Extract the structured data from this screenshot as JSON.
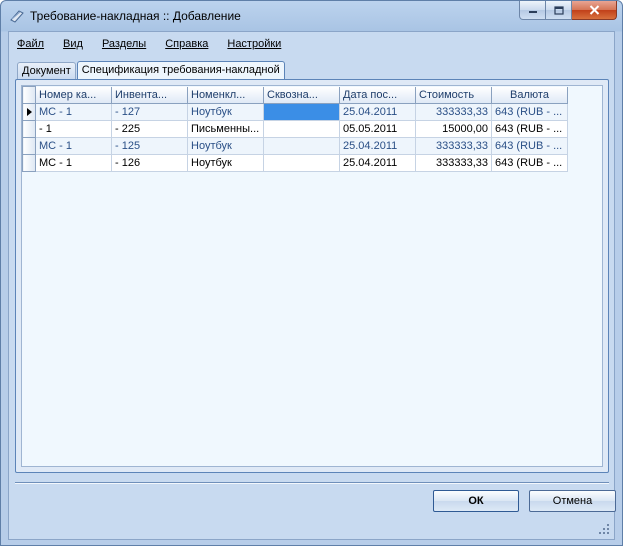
{
  "window": {
    "title": "Требование-накладная :: Добавление"
  },
  "menu": {
    "items": [
      "Файл",
      "Вид",
      "Разделы",
      "Справка",
      "Настройки"
    ]
  },
  "tabs": [
    {
      "label": "Документ",
      "active": false
    },
    {
      "label": "Спецификация требования-накладной",
      "active": true
    }
  ],
  "grid": {
    "columns": [
      "Номер ка...",
      "Инвента...",
      "Номенкл...",
      "Сквозна...",
      "Дата пос...",
      "Стоимость",
      "Валюта"
    ],
    "rows": [
      [
        "МС - 1",
        " - 127",
        "Ноутбук",
        "",
        "25.04.2011",
        "333333,33",
        "643 (RUB - ..."
      ],
      [
        " - 1",
        " - 225",
        "Письменны...",
        "",
        "05.05.2011",
        "15000,00",
        "643 (RUB - ..."
      ],
      [
        "МС - 1",
        " - 125",
        "Ноутбук",
        "",
        "25.04.2011",
        "333333,33",
        "643 (RUB - ..."
      ],
      [
        "МС - 1",
        " - 126",
        "Ноутбук",
        "",
        "25.04.2011",
        "333333,33",
        "643 (RUB - ..."
      ]
    ]
  },
  "buttons": {
    "ok": "ОК",
    "cancel": "Отмена"
  }
}
